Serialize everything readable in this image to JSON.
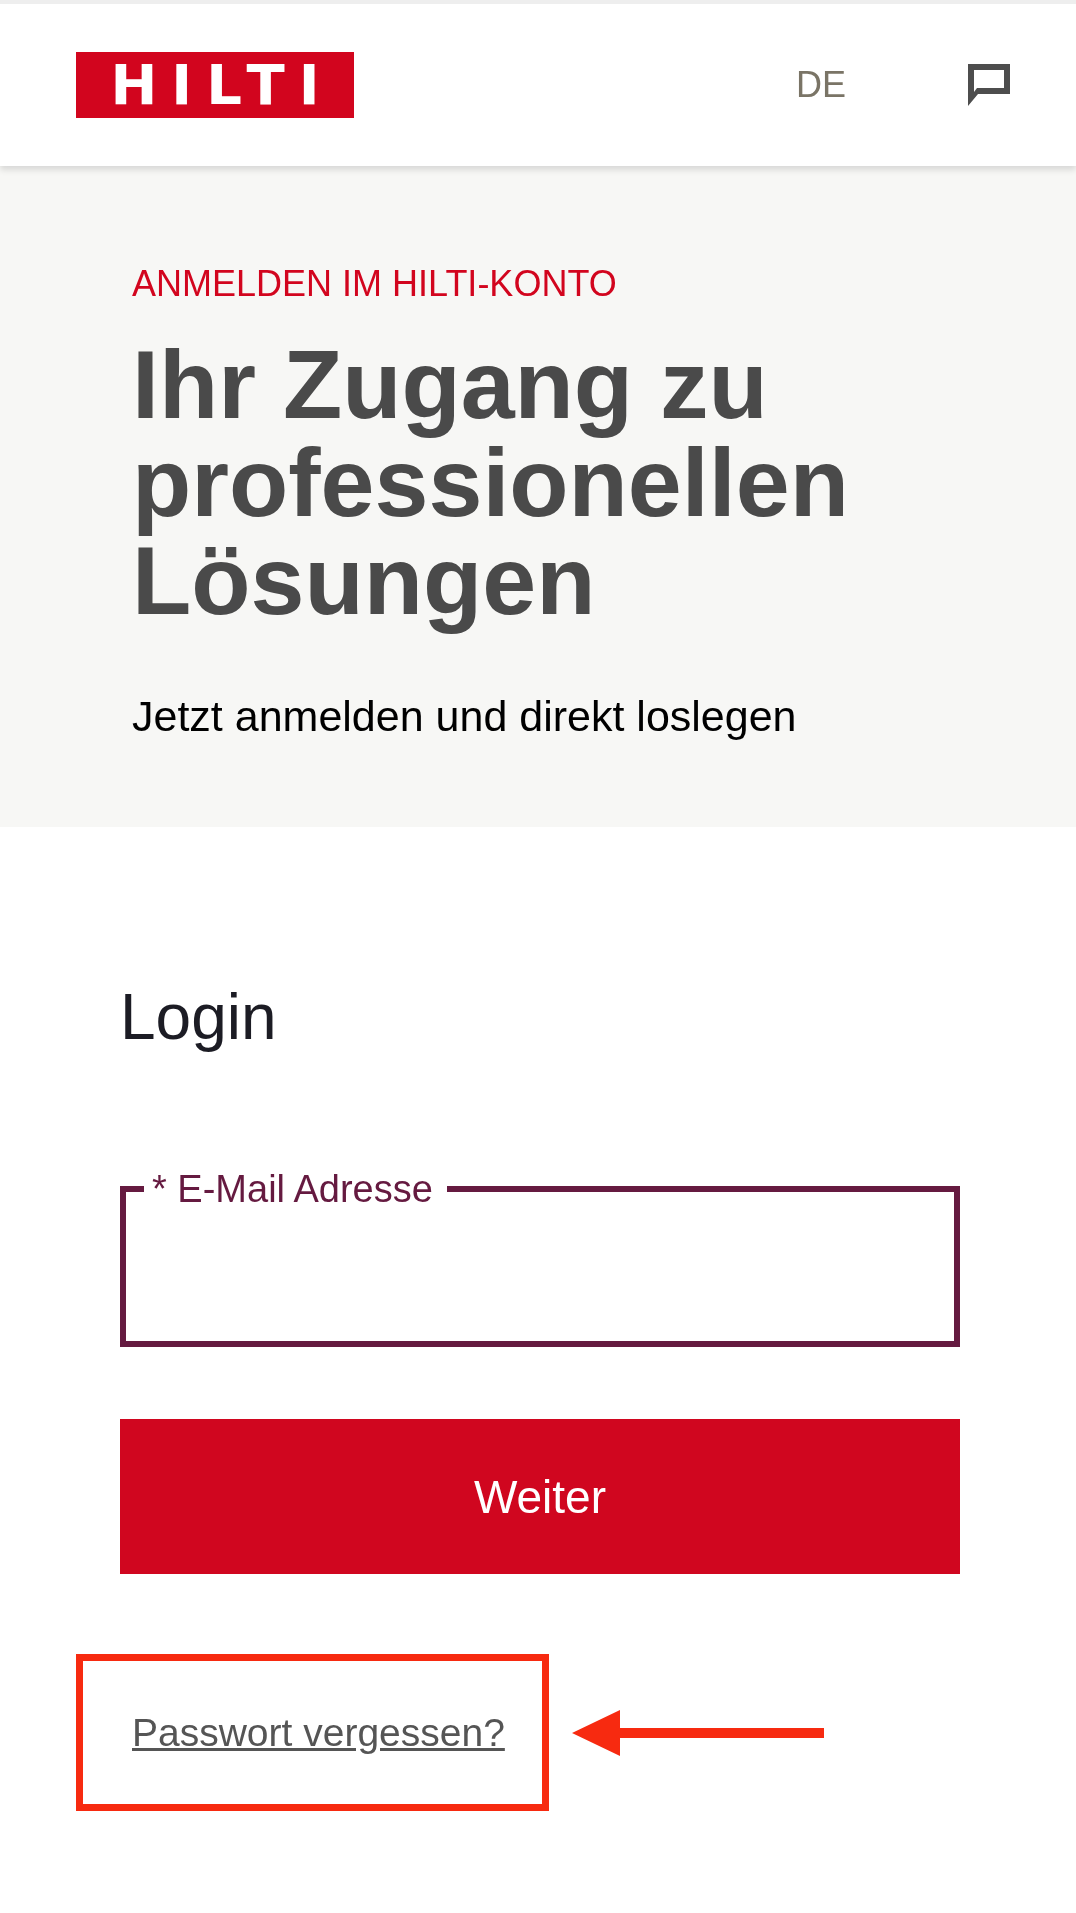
{
  "header": {
    "logo": "HILTI",
    "language": "DE"
  },
  "hero": {
    "eyebrow": "ANMELDEN IM HILTI-KONTO",
    "title": "Ihr Zugang zu professionellen Lösungen",
    "subtitle": "Jetzt anmelden und direkt loslegen"
  },
  "login": {
    "title": "Login",
    "email_field": {
      "label": "* E-Mail Adresse"
    },
    "submit_button": "Weiter",
    "forgot_link": "Passwort vergessen?"
  }
}
